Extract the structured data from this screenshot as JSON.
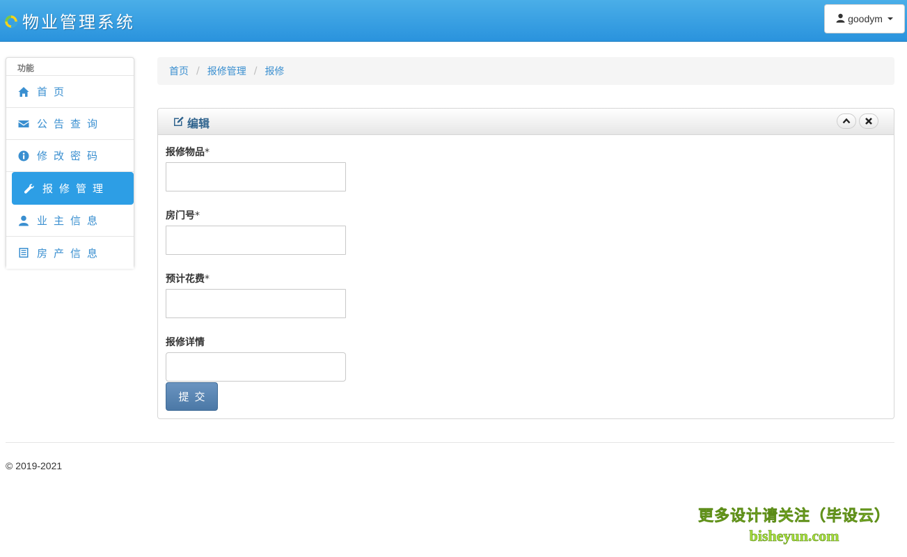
{
  "header": {
    "app_title": "物业管理系统",
    "user_label": "goodym"
  },
  "sidebar": {
    "section_label": "功能",
    "items": [
      {
        "label": "首页",
        "icon": "home-icon",
        "active": false
      },
      {
        "label": "公告查询",
        "icon": "envelope-icon",
        "active": false
      },
      {
        "label": "修改密码",
        "icon": "info-icon",
        "active": false
      },
      {
        "label": "报修管理",
        "icon": "wrench-icon",
        "active": true
      },
      {
        "label": "业主信息",
        "icon": "user-icon",
        "active": false
      },
      {
        "label": "房产信息",
        "icon": "list-icon",
        "active": false
      }
    ]
  },
  "breadcrumb": {
    "items": [
      "首页",
      "报修管理",
      "报修"
    ],
    "separator": "/"
  },
  "panel": {
    "title": "编辑",
    "fields": [
      {
        "label": "报修物品",
        "required": "*",
        "value": "",
        "placeholder": ""
      },
      {
        "label": "房门号",
        "required": "*",
        "value": "",
        "placeholder": ""
      },
      {
        "label": "预计花费",
        "required": "*",
        "value": "",
        "placeholder": ""
      },
      {
        "label": "报修详情",
        "required": "",
        "value": "",
        "placeholder": ""
      }
    ],
    "submit_label": "提交"
  },
  "footer": {
    "copyright": "© 2019-2021"
  },
  "watermark": {
    "line1": "更多设计请关注（毕设云）",
    "line2": "bisheyun.com"
  },
  "colors": {
    "topbar": "#2a93dd",
    "accent": "#3a8fd0",
    "active_nav": "#2d9ee5",
    "submit": "#4b78a6",
    "panel_title": "#30648e"
  }
}
